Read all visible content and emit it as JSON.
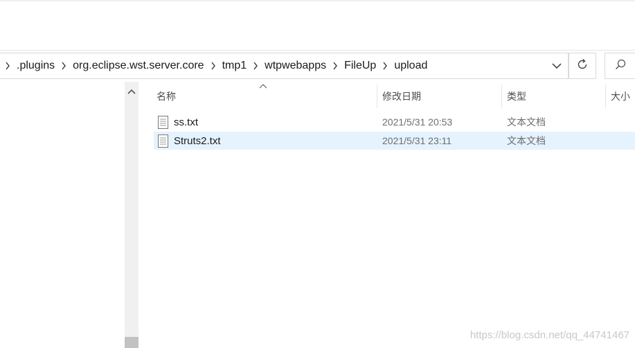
{
  "breadcrumb": {
    "items": [
      ".plugins",
      "org.eclipse.wst.server.core",
      "tmp1",
      "wtpwebapps",
      "FileUp",
      "upload"
    ]
  },
  "icons": {
    "crumb_separator": "chevron-right-icon",
    "address_dropdown": "chevron-down-icon",
    "refresh": "refresh-icon",
    "search": "search-icon",
    "file": "text-file-icon",
    "nav_scroll_up": "chevron-up-icon",
    "sort": "sort-ascending-icon"
  },
  "columns": {
    "name": "名称",
    "date": "修改日期",
    "type": "类型",
    "size": "大小"
  },
  "files": [
    {
      "name": "ss.txt",
      "date": "2021/5/31 20:53",
      "type": "文本文档",
      "selected": false
    },
    {
      "name": "Struts2.txt",
      "date": "2021/5/31 23:11",
      "type": "文本文档",
      "selected": true
    }
  ],
  "watermark": "https://blog.csdn.net/qq_44741467",
  "colors": {
    "selected_row": "#e5f3ff",
    "border": "#d9d9d9"
  }
}
